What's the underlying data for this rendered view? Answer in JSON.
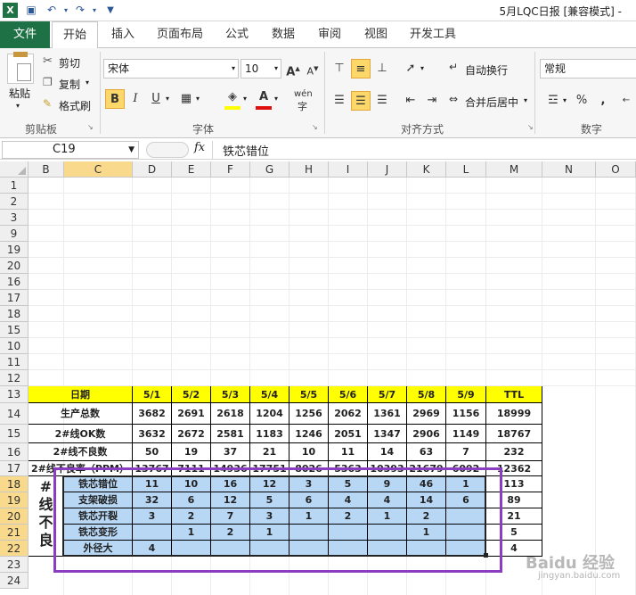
{
  "window": {
    "title": "5月LQC日报  [兼容模式]  -",
    "qat_icons": [
      "save-icon",
      "undo-icon",
      "redo-icon",
      "customize-icon"
    ]
  },
  "tabs": [
    "文件",
    "开始",
    "插入",
    "页面布局",
    "公式",
    "数据",
    "审阅",
    "视图",
    "开发工具"
  ],
  "ribbon": {
    "clipboard": {
      "paste": "粘贴",
      "cut": "剪切",
      "copy": "复制",
      "format_painter": "格式刷",
      "label": "剪贴板"
    },
    "font": {
      "name": "宋体",
      "size": "10",
      "bold": "B",
      "italic": "I",
      "underline": "U",
      "label": "字体",
      "phonetic": "wén"
    },
    "alignment": {
      "wrap": "自动换行",
      "merge": "合并后居中",
      "label": "对齐方式"
    },
    "number": {
      "format": "常规",
      "percent": "%",
      "comma": ",",
      "label": "数字"
    }
  },
  "formula_bar": {
    "cell": "C19",
    "fx": "fx",
    "value": "铁芯错位"
  },
  "columns": [
    "B",
    "C",
    "D",
    "E",
    "F",
    "G",
    "H",
    "I",
    "J",
    "K",
    "L",
    "M",
    "N",
    "O"
  ],
  "rows": [
    "1",
    "2",
    "3",
    "9",
    "19",
    "20",
    "16",
    "17",
    "18",
    "15",
    "10",
    "11",
    "12",
    "13",
    "14",
    "15",
    "16",
    "17",
    "18",
    "19",
    "20",
    "21",
    "22",
    "23",
    "24",
    "25"
  ],
  "table": {
    "header": [
      "日期",
      "5/1",
      "5/2",
      "5/3",
      "5/4",
      "5/5",
      "5/6",
      "5/7",
      "5/8",
      "5/9",
      "TTL"
    ],
    "rows": [
      [
        "生产总数",
        "3682",
        "2691",
        "2618",
        "1204",
        "1256",
        "2062",
        "1361",
        "2969",
        "1156",
        "18999"
      ],
      [
        "2#线OK数",
        "3632",
        "2672",
        "2581",
        "1183",
        "1246",
        "2051",
        "1347",
        "2906",
        "1149",
        "18767"
      ],
      [
        "2#线不良数",
        "50",
        "19",
        "37",
        "21",
        "10",
        "11",
        "14",
        "63",
        "7",
        "232"
      ],
      [
        "2#线不良率（PPM）",
        "13767",
        "7111",
        "14936",
        "17751",
        "8026",
        "5363",
        "10393",
        "21679",
        "6092",
        "12362"
      ]
    ],
    "side_text": [
      "#",
      "线",
      "不",
      "良"
    ],
    "defects": [
      [
        "铁芯错位",
        "11",
        "10",
        "16",
        "12",
        "3",
        "5",
        "9",
        "46",
        "1",
        "113"
      ],
      [
        "支架破损",
        "32",
        "6",
        "12",
        "5",
        "6",
        "4",
        "4",
        "14",
        "6",
        "89"
      ],
      [
        "铁芯开裂",
        "3",
        "2",
        "7",
        "3",
        "1",
        "2",
        "1",
        "2",
        "",
        "21"
      ],
      [
        "铁芯变形",
        "",
        "1",
        "2",
        "1",
        "",
        "",
        "",
        "1",
        "",
        "5"
      ],
      [
        "外径大",
        "4",
        "",
        "",
        "",
        "",
        "",
        "",
        "",
        "",
        "4"
      ]
    ]
  },
  "watermark": "Baidu 经验",
  "watermark_url": "jingyan.baidu.com",
  "colors": {
    "accent": "#1e7145",
    "header_fill": "#ffff00",
    "selection_fill": "#b7d7f5",
    "highlight_border": "#8b3dbf"
  }
}
